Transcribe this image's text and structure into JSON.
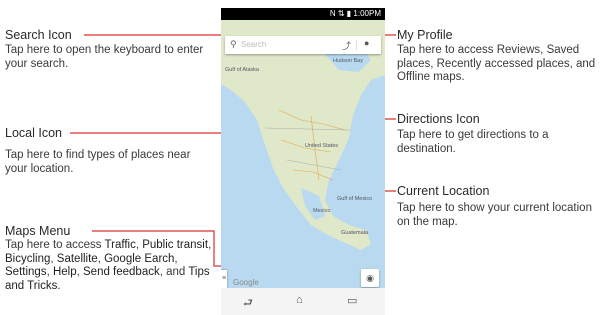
{
  "callouts": {
    "search_icon": {
      "title": "Search Icon",
      "desc": "Tap here to open the keyboard to enter your search."
    },
    "local_icon": {
      "title": "Local Icon",
      "desc": "Tap here to find types of places near your location."
    },
    "maps_menu": {
      "title": "Maps Menu",
      "desc_intro": "Tap here to access ",
      "items": [
        "Traffic",
        "Public transit",
        "Bicycling",
        "Satellite",
        "Google Earch",
        "Settings",
        "Help",
        "Send feedback"
      ],
      "desc_and": "and ",
      "last_item": "Tips and Tricks",
      "desc_end": "."
    },
    "my_profile": {
      "title": "My Profile",
      "desc": "Tap here to access Reviews, Saved places, Recently accessed places, and Offline maps."
    },
    "directions_icon": {
      "title": "Directions Icon",
      "desc": "Tap here to get directions to a destination."
    },
    "current_location": {
      "title": "Current Location",
      "desc": "Tap here to show your current location on the map."
    }
  },
  "phone": {
    "status_time": "1:00PM",
    "search_placeholder": "Search",
    "google_watermark": "Google",
    "map_labels": {
      "gulf_alaska": "Gulf of Alaska",
      "united_states": "United States",
      "mexico": "Mexico",
      "gulf_of_mexico": "Gulf of Mexico",
      "hudson_bay": "Hudson Bay",
      "guatemala": "Guatemala"
    }
  },
  "colors": {
    "leader_line": "#d9332b",
    "water": "#b8d9ef",
    "land": "#dfe8c8"
  },
  "icons": {
    "search": "search-icon",
    "directions": "directions-icon",
    "profile": "profile-icon",
    "menu": "menu-icon",
    "location": "location-icon",
    "back": "back-icon",
    "home": "home-icon",
    "recents": "recents-icon"
  }
}
